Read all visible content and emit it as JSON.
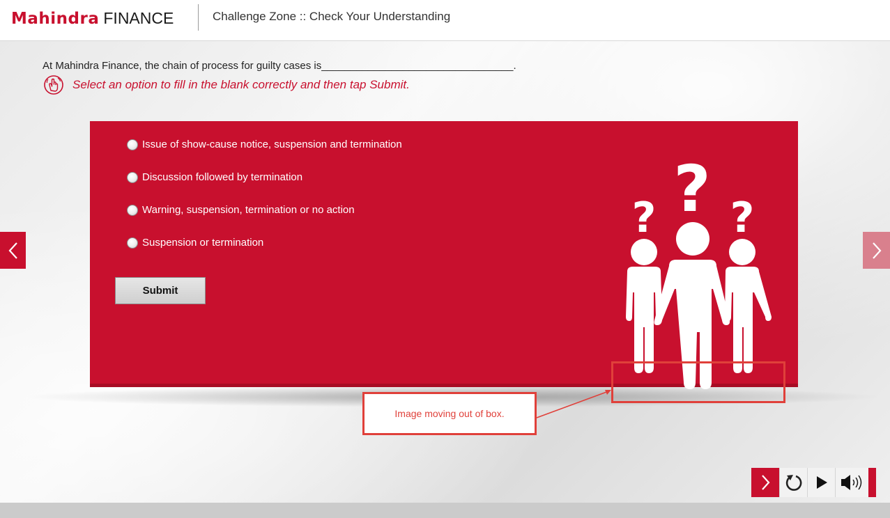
{
  "header": {
    "logo_brand": "Mahindra",
    "logo_suffix": "FINANCE",
    "title": "Challenge Zone :: Check Your Understanding"
  },
  "question": {
    "text": "At Mahindra Finance, the chain of process for guilty cases is_________________________________.",
    "instruction": "Select an option to fill in the blank correctly and then tap Submit."
  },
  "options": [
    {
      "label": "Issue of show-cause notice, suspension and termination",
      "selected": false
    },
    {
      "label": "Discussion followed by termination",
      "selected": false
    },
    {
      "label": "Warning, suspension, termination or no action",
      "selected": false
    },
    {
      "label": "Suspension or termination",
      "selected": false
    }
  ],
  "submit_label": "Submit",
  "annotation": {
    "text": "Image moving out of box."
  },
  "colors": {
    "accent": "#c8102e",
    "annotation": "#e0403a"
  },
  "icons": {
    "instruction": "tap-hand-icon",
    "nav_prev": "chevron-left-icon",
    "nav_next": "chevron-right-icon",
    "next": "chevron-right-icon",
    "replay": "replay-icon",
    "play": "play-icon",
    "volume": "volume-icon"
  }
}
